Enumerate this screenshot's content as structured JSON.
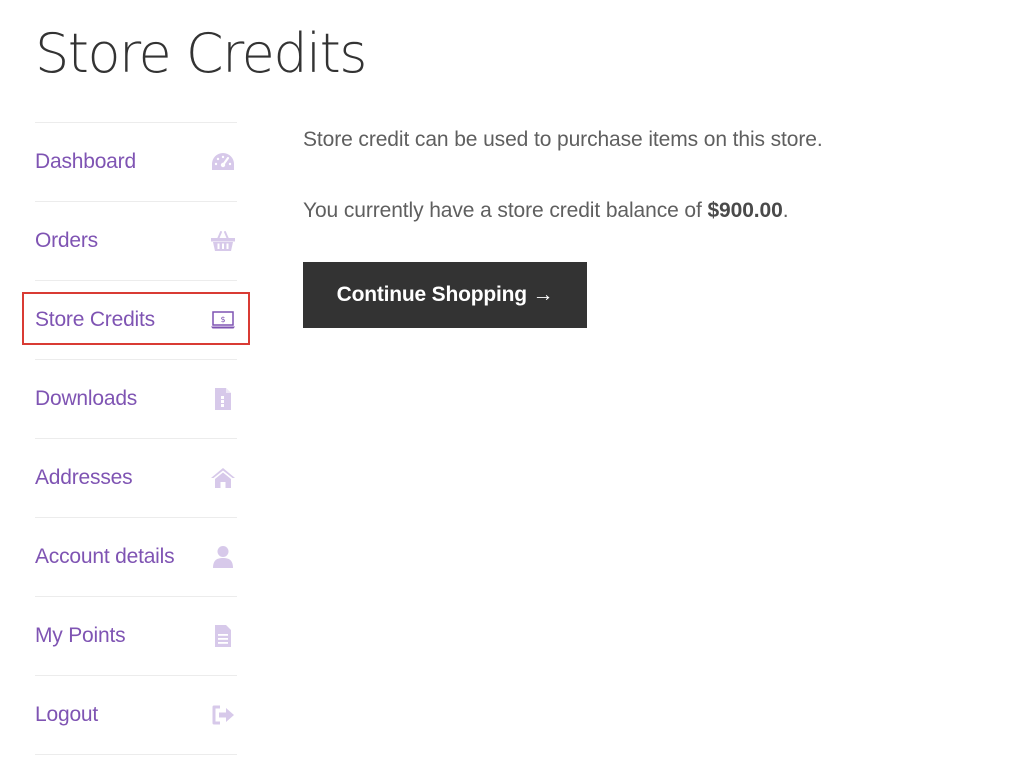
{
  "page": {
    "title": "Store Credits"
  },
  "nav": {
    "items": [
      {
        "label": "Dashboard",
        "icon": "dashboard-gauge-icon"
      },
      {
        "label": "Orders",
        "icon": "basket-icon"
      },
      {
        "label": "Store Credits",
        "icon": "laptop-dollar-icon",
        "active": true
      },
      {
        "label": "Downloads",
        "icon": "file-download-icon"
      },
      {
        "label": "Addresses",
        "icon": "home-icon"
      },
      {
        "label": "Account details",
        "icon": "user-icon"
      },
      {
        "label": "My Points",
        "icon": "document-icon"
      },
      {
        "label": "Logout",
        "icon": "sign-out-icon"
      }
    ],
    "link_color": "#7f54b3",
    "icon_color": "#d7c9ea",
    "highlight_color": "#d93b34"
  },
  "content": {
    "intro": "Store credit can be used to purchase items on this store.",
    "balance_prefix": "You currently have a store credit balance of ",
    "balance_amount": "$900.00",
    "balance_suffix": ".",
    "button_label": "Continue Shopping →"
  },
  "colors": {
    "button_bg": "#333333",
    "button_text": "#ffffff",
    "title": "#333333",
    "body_text": "#5f5f5f"
  }
}
